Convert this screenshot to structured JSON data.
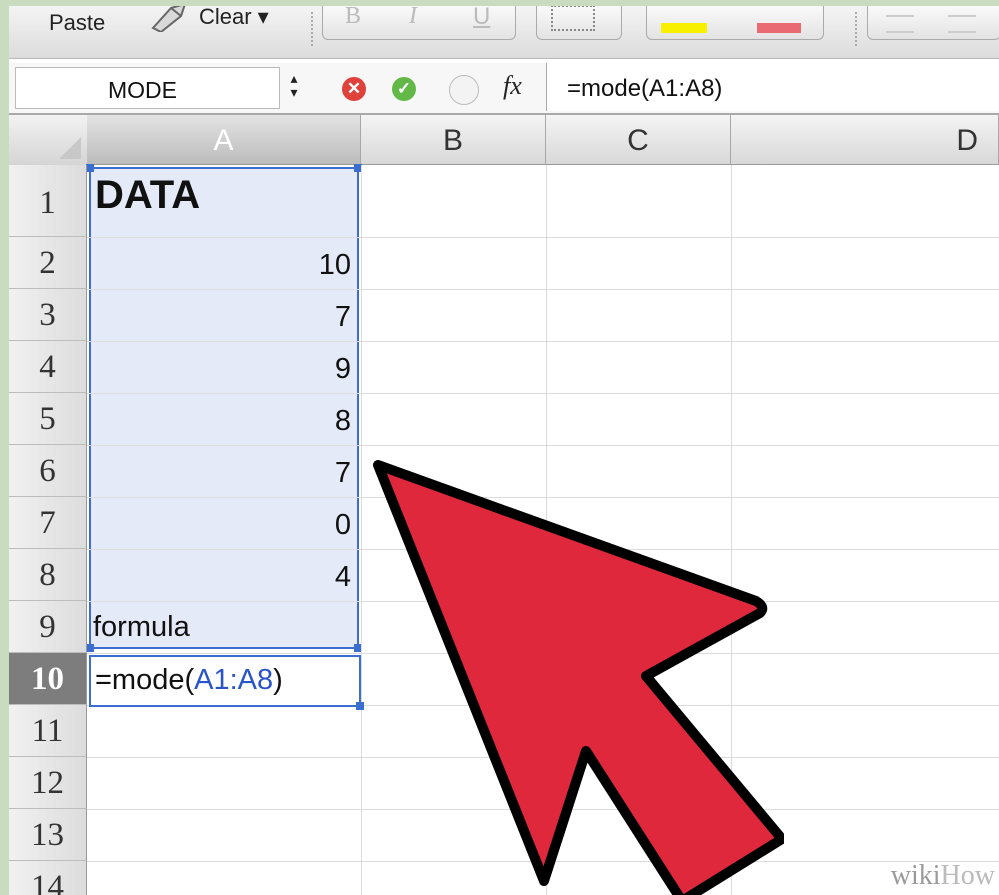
{
  "toolbar": {
    "paste_label": "Paste",
    "clear_label": "Clear ▾",
    "bold_label": "B",
    "italic_label": "I",
    "underline_label": "U"
  },
  "formula_bar": {
    "name_box": "MODE",
    "stepper_glyph": "▴\n▾",
    "cancel_glyph": "✕",
    "confirm_glyph": "✓",
    "fx_label": "fx",
    "formula": "=mode(A1:A8)"
  },
  "columns": [
    "A",
    "B",
    "C",
    "D"
  ],
  "rows": [
    "1",
    "2",
    "3",
    "4",
    "5",
    "6",
    "7",
    "8",
    "9",
    "10",
    "11",
    "12",
    "13",
    "14"
  ],
  "selected_row": "10",
  "cells": {
    "A1": "DATA",
    "A2": "10",
    "A3": "7",
    "A4": "9",
    "A5": "8",
    "A6": "7",
    "A7": "0",
    "A8": "4",
    "A9": "formula",
    "A10_prefix": "=mode(",
    "A10_ref": "A1:A8",
    "A10_suffix": ")"
  },
  "annotation": {
    "arrow_color": "#e0283d",
    "arrow_outline": "#000000"
  },
  "watermark": {
    "part1": "wiki",
    "part2": "How"
  },
  "colors": {
    "selection_border": "#3a6ed0",
    "selection_fill": "#e4eaf7",
    "cancel": "#e0413b",
    "confirm": "#62b948"
  }
}
